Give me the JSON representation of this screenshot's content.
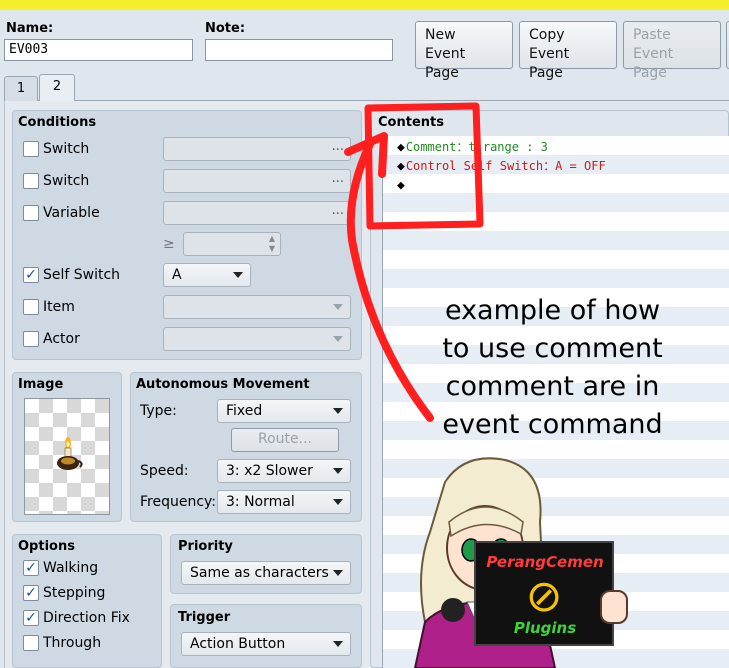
{
  "header": {
    "name_label": "Name:",
    "name_value": "EV003",
    "note_label": "Note:",
    "note_value": "",
    "buttons": {
      "new_line1": "New",
      "new_line2": "Event Page",
      "copy_line1": "Copy",
      "copy_line2": "Event Page",
      "paste_line1": "Paste",
      "paste_line2": "Event Page"
    }
  },
  "tabs": [
    "1",
    "2"
  ],
  "conditions": {
    "title": "Conditions",
    "rows": [
      {
        "label": "Switch",
        "checked": false,
        "value": "",
        "suffix": "..."
      },
      {
        "label": "Switch",
        "checked": false,
        "value": "",
        "suffix": "..."
      },
      {
        "label": "Variable",
        "checked": false,
        "value": "",
        "suffix": "..."
      },
      {
        "label": "Self Switch",
        "checked": true,
        "value": "A"
      },
      {
        "label": "Item",
        "checked": false,
        "value": ""
      },
      {
        "label": "Actor",
        "checked": false,
        "value": ""
      }
    ],
    "gte_symbol": "≥"
  },
  "image": {
    "title": "Image"
  },
  "autonomous": {
    "title": "Autonomous Movement",
    "type_label": "Type:",
    "type_value": "Fixed",
    "route_button": "Route...",
    "speed_label": "Speed:",
    "speed_value": "3: x2 Slower",
    "frequency_label": "Frequency:",
    "frequency_value": "3: Normal"
  },
  "options": {
    "title": "Options",
    "items": [
      {
        "label": "Walking",
        "checked": true
      },
      {
        "label": "Stepping",
        "checked": true
      },
      {
        "label": "Direction Fix",
        "checked": true
      },
      {
        "label": "Through",
        "checked": false
      }
    ]
  },
  "priority": {
    "title": "Priority",
    "value": "Same as characters"
  },
  "trigger": {
    "title": "Trigger",
    "value": "Action Button"
  },
  "contents": {
    "title": "Contents",
    "commands": [
      {
        "text": "Comment：t range : 3",
        "color": "#1f8a1f"
      },
      {
        "text": "Control Self Switch：A = OFF",
        "color": "#d11a1a"
      },
      {
        "text": "",
        "color": "#000000"
      }
    ],
    "diamond": "◆"
  },
  "annotation": {
    "lines": [
      "example of how",
      "to use comment",
      "comment are in",
      "event command"
    ],
    "color": "#ff1f1f"
  },
  "logo": {
    "line1": "PerangCemen",
    "line2": "Plugins",
    "symbol": "⊘"
  },
  "check_mark": "✓"
}
